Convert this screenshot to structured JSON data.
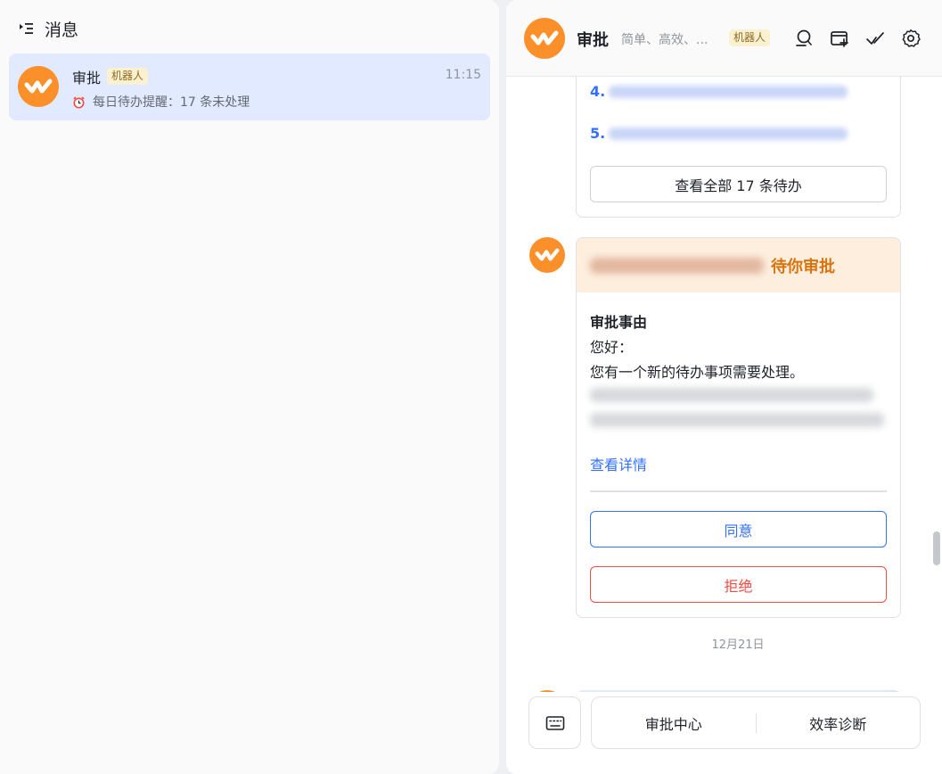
{
  "left": {
    "header_title": "消息",
    "chat_item": {
      "name": "审批",
      "badge": "机器人",
      "time": "11:15",
      "preview": "每日待办提醒：17 条未处理"
    }
  },
  "right": {
    "header": {
      "name": "审批",
      "description": "简单、高效、...",
      "badge": "机器人"
    },
    "list_card": {
      "items": [
        "4.",
        "5."
      ],
      "view_all_label": "查看全部 17 条待办"
    },
    "approval_card": {
      "header_title": "待你审批",
      "reason_label": "审批事由",
      "greeting": "您好：",
      "body": "您有一个新的待办事项需要处理。",
      "details_link": "查看详情",
      "agree_label": "同意",
      "reject_label": "拒绝"
    },
    "date_separator": "12月21日",
    "bottom_menu": {
      "item1": "审批中心",
      "item2": "效率诊断"
    }
  },
  "colors": {
    "brand_orange": "#fb8f2a",
    "link_blue": "#3370ff",
    "reject_red": "#f54a45",
    "selected_bg": "#e1eaff"
  }
}
